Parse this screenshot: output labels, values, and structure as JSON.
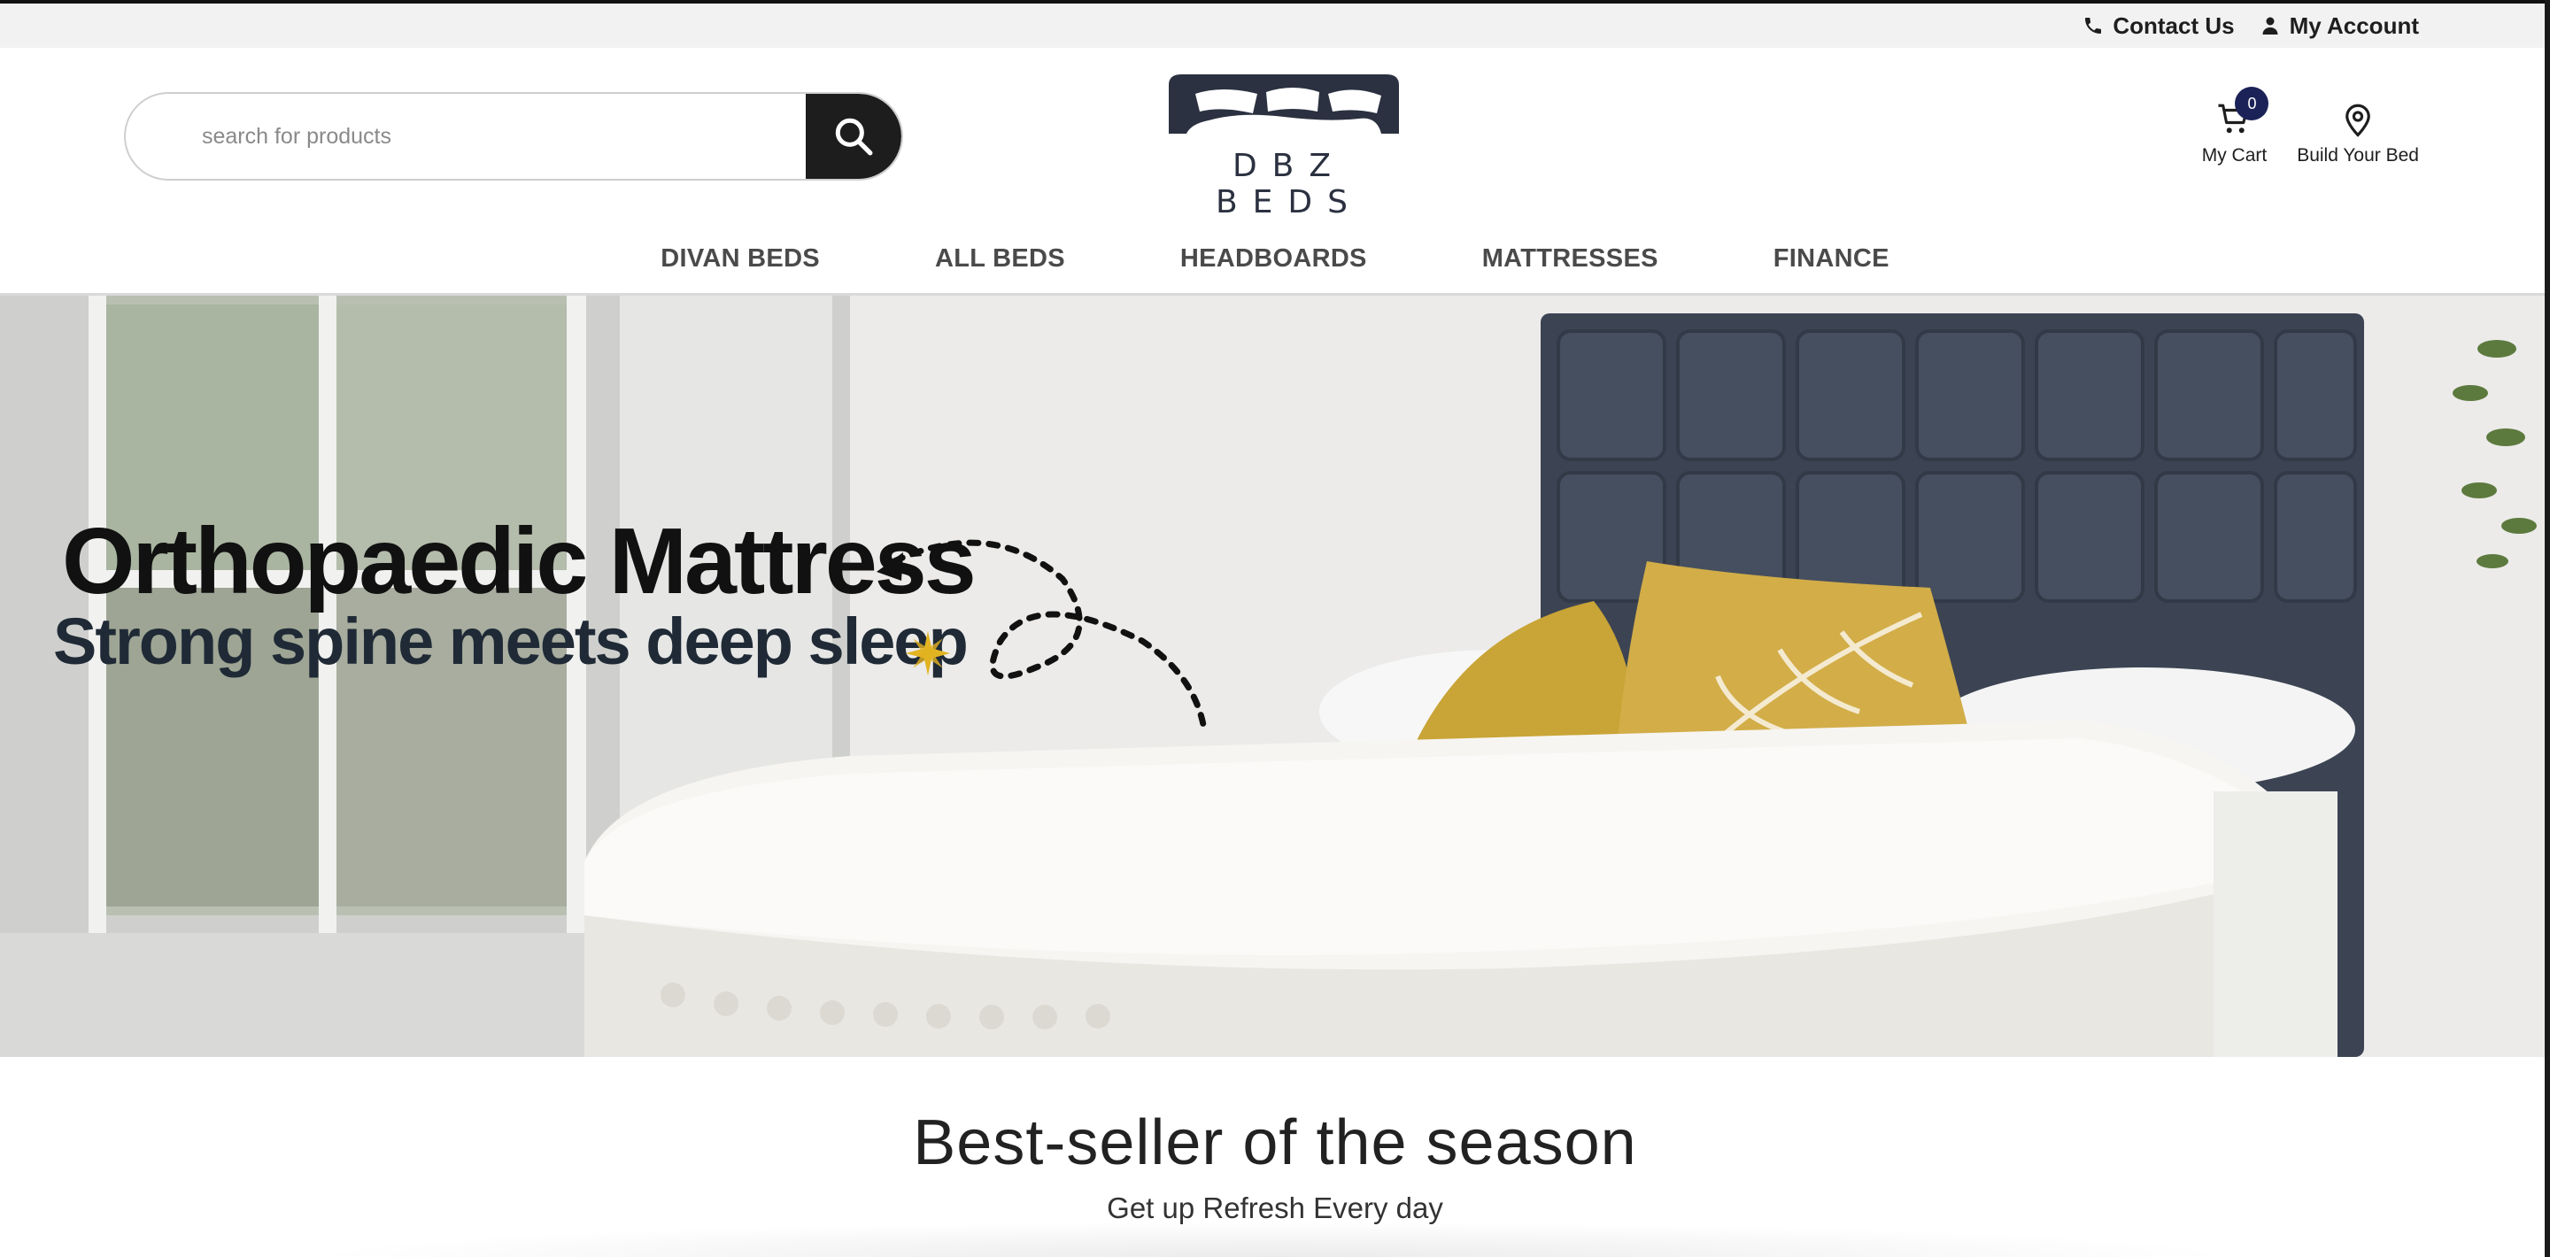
{
  "topbar": {
    "contact_label": "Contact Us",
    "account_label": "My Account"
  },
  "header": {
    "search_placeholder": "search for products",
    "logo_text": "DBZ BEDS",
    "cart_label": "My Cart",
    "cart_count": "0",
    "build_label": "Build Your Bed"
  },
  "nav": {
    "items": [
      {
        "label": "DIVAN BEDS"
      },
      {
        "label": "ALL BEDS"
      },
      {
        "label": "HEADBOARDS"
      },
      {
        "label": "MATTRESSES"
      },
      {
        "label": "FINANCE"
      }
    ]
  },
  "hero": {
    "title": "Orthopaedic Mattress",
    "subtitle": "Strong spine meets deep sleep"
  },
  "bestsellers": {
    "title": "Best-seller of the season",
    "subtitle": "Get up Refresh Every day"
  },
  "colors": {
    "brand_navy": "#1b2257",
    "search_button": "#1d1d1d",
    "headboard": "#3c4453"
  }
}
